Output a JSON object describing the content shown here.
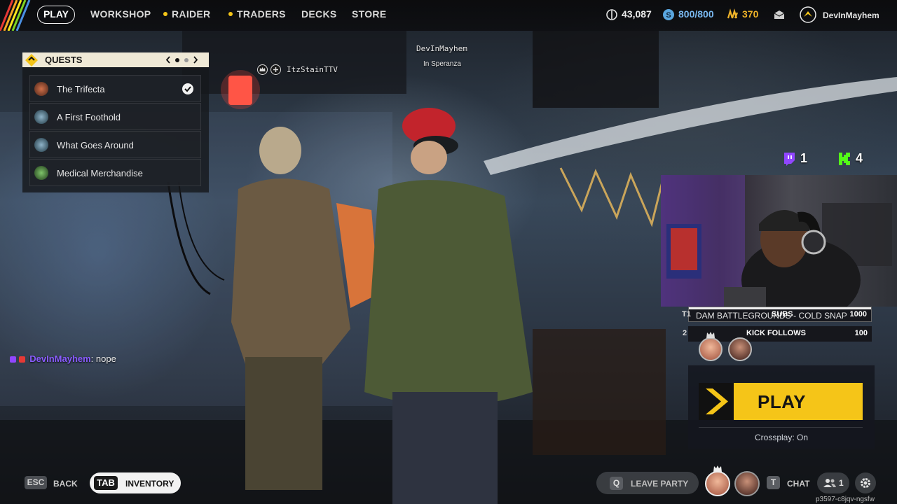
{
  "topbar": {
    "nav": [
      {
        "label": "PLAY",
        "active": true
      },
      {
        "label": "WORKSHOP",
        "badge": false
      },
      {
        "label": "RAIDER",
        "badge": true
      },
      {
        "label": "TRADERS",
        "badge": true
      },
      {
        "label": "DECKS",
        "badge": false
      },
      {
        "label": "STORE",
        "badge": false
      }
    ],
    "currency_coins": "43,087",
    "currency_raider_tokens": "800/800",
    "currency_cred": "370",
    "username": "DevInMayhem",
    "icons": [
      "coins-icon",
      "raider-token-icon",
      "cred-icon",
      "mail-icon",
      "profile-rank-icon"
    ],
    "badge_color": "#f5c518"
  },
  "quests": {
    "title": "QUESTS",
    "items": [
      {
        "label": "The Trifecta",
        "completed": true
      },
      {
        "label": "A First Foothold",
        "completed": false
      },
      {
        "label": "What Goes Around",
        "completed": false
      },
      {
        "label": "Medical Merchandise",
        "completed": false
      }
    ]
  },
  "scene": {
    "local_player_name": "DevInMayhem",
    "local_player_status": "In Speranza",
    "party_member_name": "ItzStainTTV"
  },
  "chat": {
    "user": "DevInMayhem",
    "message": ": nope"
  },
  "stream": {
    "twitch_count": "1",
    "kick_count": "4",
    "ticker_text": "DAM BATTLEGROUNDS - COLD SNAP",
    "goals": [
      {
        "left": "T1",
        "label": "SUBS",
        "target": "1000"
      },
      {
        "left": "2",
        "label": "KICK FOLLOWS",
        "target": "100"
      }
    ],
    "twitch_color": "#9146ff",
    "kick_color": "#53fc18"
  },
  "play_panel": {
    "button_label": "PLAY",
    "crossplay": "Crossplay: On",
    "accent": "#f5c518"
  },
  "bottom": {
    "esc_key": "ESC",
    "back_label": "BACK",
    "tab_key": "TAB",
    "inventory_label": "INVENTORY",
    "leave_key": "Q",
    "leave_label": "LEAVE PARTY",
    "chat_key": "T",
    "chat_label": "CHAT",
    "party_count": "1",
    "session_id": "p3597-c8jqv-ngsfw"
  }
}
